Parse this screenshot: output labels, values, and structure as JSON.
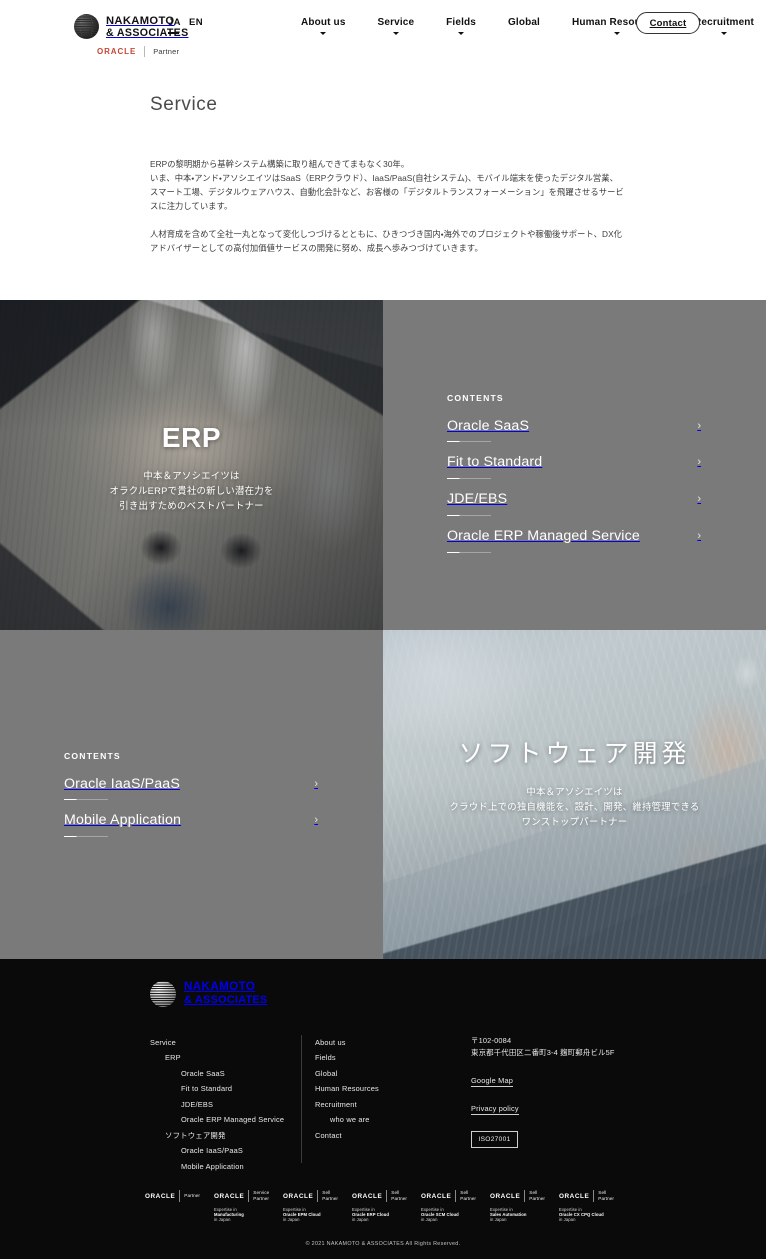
{
  "header": {
    "logo_line1": "NAKAMOTO",
    "logo_line2": "& ASSOCIATES",
    "lang": [
      {
        "label": "JA",
        "active": true
      },
      {
        "label": "EN",
        "active": false
      }
    ],
    "oracle_badge": {
      "oracle": "ORACLE",
      "partner": "Partner"
    },
    "nav": [
      {
        "label": "About us",
        "has_dropdown": true
      },
      {
        "label": "Service",
        "has_dropdown": true
      },
      {
        "label": "Fields",
        "has_dropdown": true
      },
      {
        "label": "Global",
        "has_dropdown": false
      },
      {
        "label": "Human Resources",
        "has_dropdown": true
      },
      {
        "label": "Recruitment",
        "has_dropdown": true
      }
    ],
    "contact_label": "Contact"
  },
  "intro": {
    "title": "Service",
    "paragraph1": "ERPの黎明期から基幹システム構築に取り組んできてまもなく30年。\nいま、中本・アンド・アソシエイツはSaaS（ERPクラウド）、IaaS/PaaS(自社システム)、モバイル端末を使ったデジタル営業、スマート工場、デジタルウェアハウス、自動化会計など、お客様の「デジタルトランスフォーメーション」を飛躍させるサービスに注力しています。",
    "paragraph2": "人材育成を含めて全社一丸となって変化しつづけるとともに、ひきつづき国内・海外でのプロジェクトや稼働後サポート、DX化アドバイザーとしての高付加価値サービスの開発に努め、成長へ歩みつづけていきます。"
  },
  "services": [
    {
      "key": "erp",
      "title_en": "ERP",
      "subtitle": "中本＆アソシエイツは\nオラクルERPで貴社の新しい潜在力を\n引き出すためのベストパートナー",
      "contents_label": "CONTENTS",
      "items": [
        {
          "label": "Oracle SaaS",
          "chevron": "›"
        },
        {
          "label": "Fit to Standard",
          "chevron": "›"
        },
        {
          "label": "JDE/EBS",
          "chevron": "›"
        },
        {
          "label": "Oracle ERP Managed Service",
          "chevron": "›"
        }
      ]
    },
    {
      "key": "software-development",
      "title_ja": "ソフトウェア開発",
      "subtitle": "中本＆アソシエイツは\nクラウド上での独自機能を、設計、開発、維持管理できる\nワンストップパートナー",
      "contents_label": "CONTENTS",
      "items": [
        {
          "label": "Oracle IaaS/PaaS",
          "chevron": "›"
        },
        {
          "label": "Mobile Application",
          "chevron": "›"
        }
      ]
    }
  ],
  "footer": {
    "logo_line1": "NAKAMOTO",
    "logo_line2": "& ASSOCIATES",
    "col1": [
      {
        "label": "Service",
        "indent": 0
      },
      {
        "label": "ERP",
        "indent": 1
      },
      {
        "label": "Oracle SaaS",
        "indent": 2
      },
      {
        "label": "Fit to Standard",
        "indent": 2
      },
      {
        "label": "JDE/EBS",
        "indent": 2
      },
      {
        "label": "Oracle ERP Managed Service",
        "indent": 2
      },
      {
        "label": "ソフトウェア開発",
        "indent": 1
      },
      {
        "label": "Oracle IaaS/PaaS",
        "indent": 2
      },
      {
        "label": "Mobile Application",
        "indent": 2
      }
    ],
    "col2": [
      {
        "label": "About us",
        "indent": 0
      },
      {
        "label": "Fields",
        "indent": 0
      },
      {
        "label": "Global",
        "indent": 0
      },
      {
        "label": "Human Resources",
        "indent": 0
      },
      {
        "label": "Recruitment",
        "indent": 0
      },
      {
        "label": "who we are",
        "indent": 1
      },
      {
        "label": "Contact",
        "indent": 0
      }
    ],
    "postal_code": "〒102-0084",
    "address": "東京都千代田区二番町3-4 麹町郵舟ビル5F",
    "google_map": "Google Map",
    "privacy_policy": "Privacy policy",
    "iso": "ISO27001",
    "badges": [
      {
        "oracle": "ORACLE",
        "role": "Partner",
        "sub_bold": "",
        "sub_line1": "",
        "sub_line2": ""
      },
      {
        "oracle": "ORACLE",
        "role": "Service\nPartner",
        "sub_pre": "Expertise in",
        "sub_bold": "Manufacturing",
        "sub_post": "in Japan"
      },
      {
        "oracle": "ORACLE",
        "role": "Sell\nPartner",
        "sub_pre": "Expertise in",
        "sub_bold": "Oracle EPM Cloud",
        "sub_post": "in Japan"
      },
      {
        "oracle": "ORACLE",
        "role": "Sell\nPartner",
        "sub_pre": "Expertise in",
        "sub_bold": "Oracle ERP Cloud",
        "sub_post": "in Japan"
      },
      {
        "oracle": "ORACLE",
        "role": "Sell\nPartner",
        "sub_pre": "Expertise in",
        "sub_bold": "Oracle SCM Cloud",
        "sub_post": "in Japan"
      },
      {
        "oracle": "ORACLE",
        "role": "Sell\nPartner",
        "sub_pre": "Expertise in",
        "sub_bold": "Sales Automation",
        "sub_post": "in Japan"
      },
      {
        "oracle": "ORACLE",
        "role": "Sell\nPartner",
        "sub_pre": "Expertise in",
        "sub_bold": "Oracle CX CPQ Cloud",
        "sub_post": "in Japan"
      }
    ],
    "copyright": "© 2021 NAKAMOTO & ASSOCIATES All Rights Reserved."
  },
  "colors": {
    "panel_gray": "#7a7a7a",
    "footer_bg": "#0a0a0a",
    "oracle_red": "#c74634",
    "title_gray": "#4b4b4b"
  }
}
